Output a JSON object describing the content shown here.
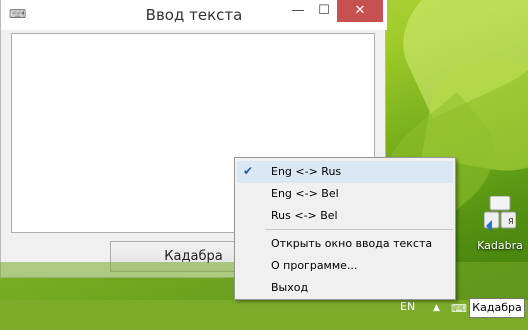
{
  "window": {
    "title": "Ввод текста",
    "minimize_glyph": "—",
    "maximize_glyph": "☐",
    "close_glyph": "✕",
    "text_value": "",
    "button_label": "Кадабра"
  },
  "menu": {
    "items": [
      {
        "label": "Eng <-> Rus",
        "checked": true
      },
      {
        "label": "Eng <-> Bel",
        "checked": false
      },
      {
        "label": "Rus <-> Bel",
        "checked": false
      },
      {
        "label": "Открыть окно ввода текста",
        "checked": false
      },
      {
        "label": "О программе...",
        "checked": false
      },
      {
        "label": "Выход",
        "checked": false
      }
    ],
    "check_glyph": "✔"
  },
  "desktop": {
    "icon_label": "Kadabra",
    "icon_name": "keyboard-icon"
  },
  "tray": {
    "language": "EN",
    "arrow": "▲",
    "tooltip": "Кадабра"
  },
  "colors": {
    "close_button": "#c75050",
    "menu_highlight": "#dae7f5",
    "desktop_green": "#9fcb2a"
  }
}
